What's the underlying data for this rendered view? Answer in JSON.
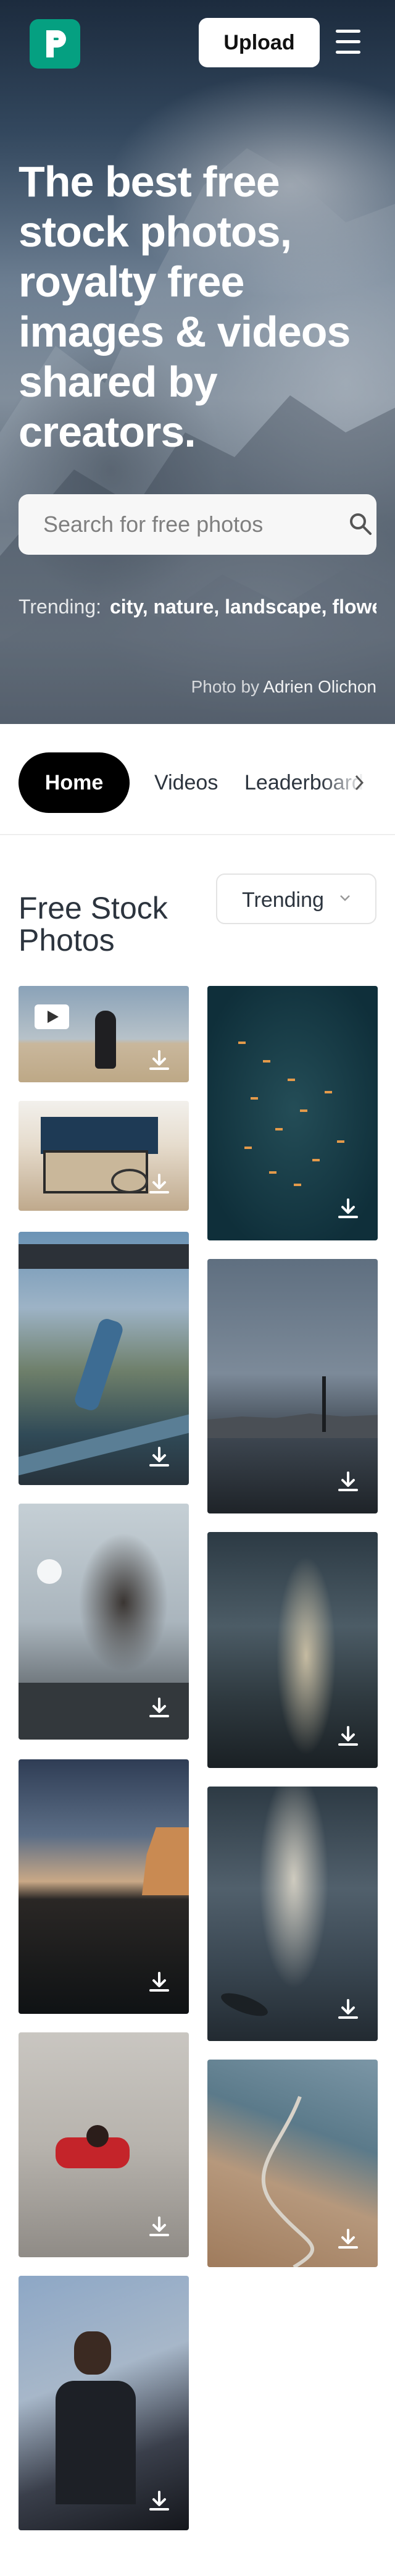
{
  "header": {
    "logo_icon": "pexels-logo-icon",
    "upload_label": "Upload",
    "menu_icon": "hamburger-menu-icon"
  },
  "hero": {
    "title": "The best free stock photos, royalty free images & videos shared by creators.",
    "search_placeholder": "Search for free photos",
    "trending_label": "Trending:",
    "trending_tags": "city, nature, landscape, flowers",
    "credit_prefix": "Photo by",
    "credit_author": "Adrien Olichon"
  },
  "nav": {
    "tabs": [
      {
        "label": "Home",
        "active": true
      },
      {
        "label": "Videos",
        "active": false
      },
      {
        "label": "Leaderboard",
        "active": false
      }
    ]
  },
  "section": {
    "title": "Free Stock Photos",
    "sort_value": "Trending"
  },
  "colors": {
    "brand": "#05a081",
    "text": "#2c343e",
    "active_tab_bg": "#000000"
  }
}
